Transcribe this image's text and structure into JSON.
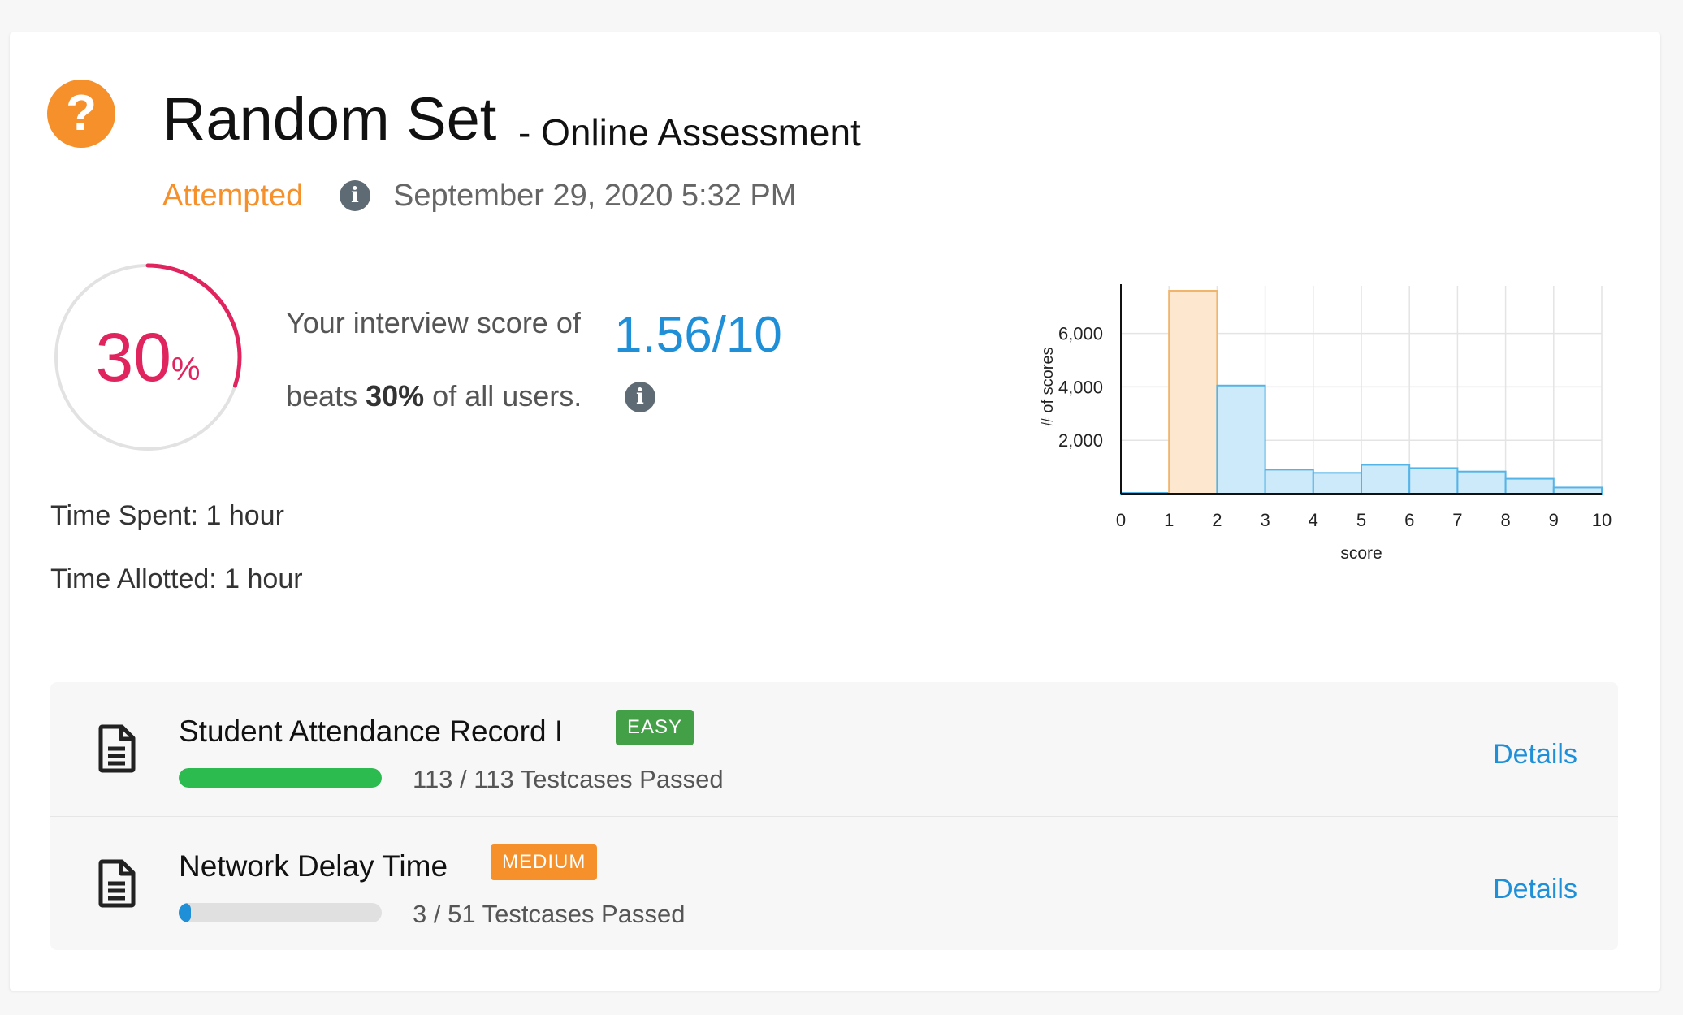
{
  "header": {
    "title": "Random Set",
    "subtitle": "- Online Assessment",
    "status": "Attempted",
    "date": "September 29, 2020 5:32 PM",
    "icon": "question-icon"
  },
  "score": {
    "percent": "30",
    "percent_sign": "%",
    "percent_value": 30,
    "text_before": "Your interview score of",
    "value": "1.56/10",
    "beats_prefix": "beats",
    "beats_value": "30%",
    "beats_suffix": "of all users."
  },
  "time": {
    "spent": "Time Spent: 1 hour",
    "allotted": "Time Allotted: 1 hour"
  },
  "colors": {
    "accent_orange": "#f5902b",
    "score_red": "#e0245e",
    "link_blue": "#1f8fd8",
    "easy_green": "#43a047"
  },
  "chart_data": {
    "type": "bar",
    "categories": [
      "0",
      "1",
      "2",
      "3",
      "4",
      "5",
      "6",
      "7",
      "8",
      "9"
    ],
    "x_ticks": [
      "0",
      "1",
      "2",
      "3",
      "4",
      "5",
      "6",
      "7",
      "8",
      "9",
      "10"
    ],
    "values": [
      30,
      7600,
      4050,
      900,
      780,
      1080,
      960,
      830,
      560,
      230
    ],
    "highlight_index": 1,
    "xlabel": "score",
    "ylabel": "# of scores",
    "y_ticks": [
      2000,
      4000,
      6000
    ],
    "y_tick_labels": [
      "2,000",
      "4,000",
      "6,000"
    ],
    "ylim": [
      0,
      7600
    ],
    "xlim": [
      0,
      10
    ],
    "grid": true
  },
  "problems": [
    {
      "name": "Student Attendance Record I",
      "difficulty": "EASY",
      "passed_text": "113 / 113 Testcases Passed",
      "progress": 1.0,
      "details": "Details"
    },
    {
      "name": "Network Delay Time",
      "difficulty": "MEDIUM",
      "passed_text": "3 / 51 Testcases Passed",
      "progress": 0.059,
      "details": "Details"
    }
  ]
}
